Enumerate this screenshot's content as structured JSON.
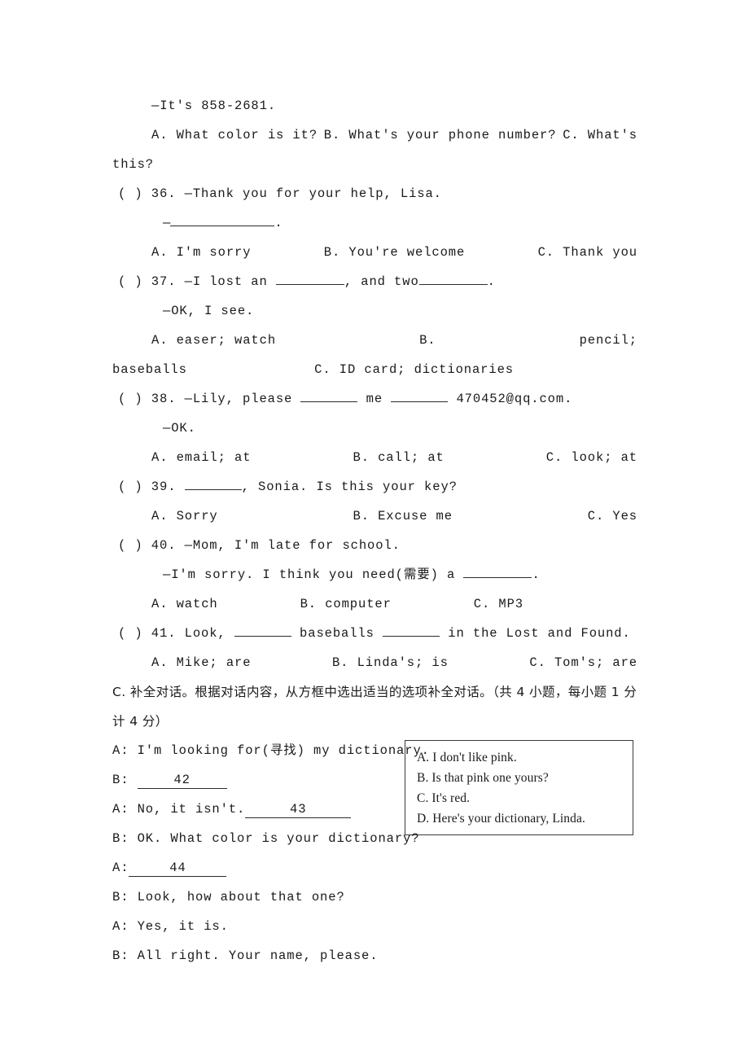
{
  "document": {
    "type": "english-exam-worksheet",
    "page_background": "#ffffff",
    "text_color": "#1a1a1a"
  },
  "top_block": {
    "answer_line": "—It's 858-2681.",
    "option_a": "A. What color is it?",
    "option_b": "B. What's your phone number?",
    "option_c": "C. What's",
    "wrap_line": "this?"
  },
  "questions": [
    {
      "id": "36",
      "marker": "(    ) 36.",
      "stem": "—Thank you for your help, Lisa.",
      "stem2_dash": "—",
      "stem2_tail": ".",
      "options": [
        "A. I'm sorry",
        "B. You're welcome",
        "C. Thank you"
      ]
    },
    {
      "id": "37",
      "marker": "(    ) 37.",
      "stem_pre": "—I lost an ",
      "stem_mid": ", and two",
      "stem_post": ".",
      "stem2": "—OK, I see.",
      "option_a": "A. easer; watch",
      "option_b_label": "B.",
      "option_b_text": "pencil;",
      "option_b_wrap": "baseballs",
      "option_c": "C. ID card; dictionaries"
    },
    {
      "id": "38",
      "marker": "(    ) 38.",
      "stem_pre": "—Lily, please ",
      "stem_mid": " me ",
      "stem_post": " 470452@qq.com.",
      "stem2": "—OK.",
      "options": [
        "A. email; at",
        "B. call; at",
        "C. look; at"
      ]
    },
    {
      "id": "39",
      "marker": "(    ) 39.",
      "stem_pre": " ",
      "stem_post": ", Sonia. Is this your key?",
      "options": [
        "A. Sorry",
        "B. Excuse me",
        "C. Yes"
      ]
    },
    {
      "id": "40",
      "marker": "(    ) 40.",
      "stem": "—Mom, I'm late for school.",
      "stem2_pre": "—I'm sorry. I think you need(需要) a ",
      "stem2_post": ".",
      "options": [
        "A. watch",
        "B. computer",
        "C. MP3"
      ]
    },
    {
      "id": "41",
      "marker": "(    ) 41.",
      "stem_pre": "Look, ",
      "stem_mid": " baseballs ",
      "stem_post": " in the Lost and Found.",
      "options": [
        "A. Mike; are",
        "B. Linda's; is",
        "C. Tom's; are"
      ]
    }
  ],
  "section_c": {
    "heading_line1": "C. 补全对话。根据对话内容，从方框中选出适当的选项补全对话。（共 4 小题，每小题 1 分",
    "heading_line2": "计 4 分）",
    "dialogue": [
      {
        "speaker": "A:",
        "text": "I'm looking for(寻找) my dictionary."
      },
      {
        "speaker": "B:",
        "blank_number": "42"
      },
      {
        "speaker": "A:",
        "text": "No, it isn't.",
        "blank_number": "43"
      },
      {
        "speaker": "B:",
        "text": "OK. What color is your dictionary?"
      },
      {
        "speaker": "A:",
        "blank_number": "44"
      },
      {
        "speaker": "B:",
        "text": "Look, how about that one?"
      },
      {
        "speaker": "A:",
        "text": "Yes, it is."
      },
      {
        "speaker": "B:",
        "text": "All right. Your name, please."
      }
    ],
    "option_box": {
      "items": [
        "A. I don't like pink.",
        "B. Is that pink one yours?",
        "C. It's red.",
        "D. Here's your dictionary, Linda."
      ]
    }
  }
}
